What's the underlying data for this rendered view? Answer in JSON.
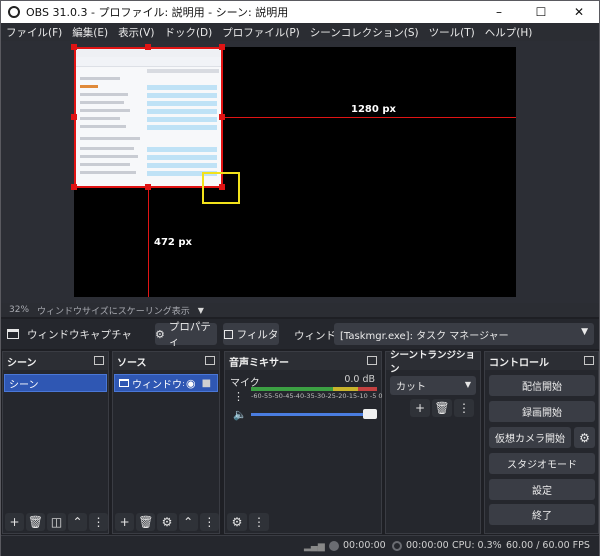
{
  "window": {
    "title": "OBS 31.0.3 - プロファイル: 説明用 - シーン: 説明用",
    "minimize_icon": "minimize-icon",
    "maximize_icon": "maximize-icon",
    "close_icon": "close-icon"
  },
  "menu": [
    "ファイル(F)",
    "編集(E)",
    "表示(V)",
    "ドック(D)",
    "プロファイル(P)",
    "シーンコレクション(S)",
    "ツール(T)",
    "ヘルプ(H)"
  ],
  "preview": {
    "width_label": "1280 px",
    "height_label": "472 px",
    "zoom": "32%",
    "scaling_mode": "ウィンドウサイズにスケーリング表示"
  },
  "source_bar": {
    "source_name": "ウィンドウキャプチャ",
    "properties": "プロパティ",
    "filters": "フィルタ",
    "window_label": "ウィンドウ",
    "window_value": "[Taskmgr.exe]: タスク マネージャー"
  },
  "docks": {
    "scenes": {
      "title": "シーン",
      "items": [
        "シーン"
      ]
    },
    "sources": {
      "title": "ソース",
      "items": [
        "ウィンドウキャ"
      ]
    },
    "mixer": {
      "title": "音声ミキサー",
      "channel": "マイク",
      "level": "0.0 dB",
      "scale": "-60-55-50-45-40-35-30-25-20-15-10 -5  0"
    },
    "transitions": {
      "title": "シーントランジション",
      "selected": "カット"
    },
    "controls": {
      "title": "コントロール",
      "buttons": [
        "配信開始",
        "録画開始",
        "仮想カメラ開始",
        "スタジオモード",
        "設定",
        "終了"
      ]
    }
  },
  "status": {
    "stream_time": "00:00:00",
    "record_time": "00:00:00",
    "cpu": "CPU: 0.3%",
    "fps": "60.00 / 60.00 FPS"
  },
  "colors": {
    "accent": "#2f57b3",
    "guide": "#e01414",
    "highlight": "#f2e21b"
  }
}
